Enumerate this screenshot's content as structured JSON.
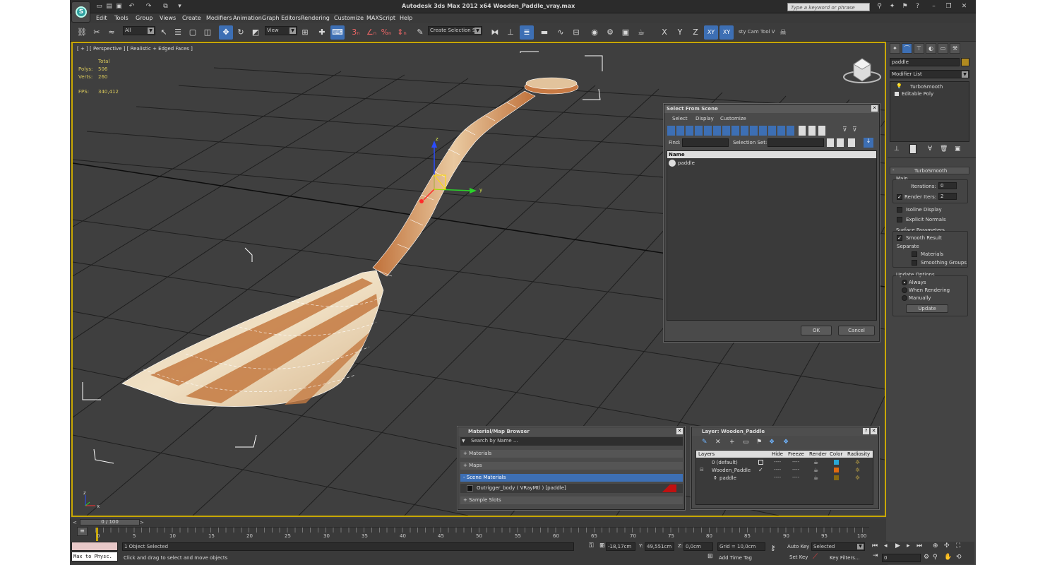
{
  "window": {
    "title": "Autodesk 3ds Max  2012 x64     Wooden_Paddle_vray.max",
    "search_placeholder": "Type a keyword or phrase"
  },
  "menu": [
    "Edit",
    "Tools",
    "Group",
    "Views",
    "Create",
    "Modifiers",
    "Animation",
    "Graph Editors",
    "Rendering",
    "Customize",
    "MAXScript",
    "Help"
  ],
  "toolbar": {
    "filter_value": "All",
    "ref_coord_value": "View",
    "named_selection_placeholder": "Create Selection Se",
    "axis_x": "X",
    "axis_y": "Y",
    "axis_z": "Z",
    "axis_xy": "XY",
    "axis_xy2": "XY",
    "extra_label": "sty Cam Tool V"
  },
  "viewport": {
    "label": "[ + ] [ Perspective ] [ Realistic + Edged Faces ]",
    "stats_header": "Total",
    "polys_label": "Polys:",
    "polys_value": "506",
    "verts_label": "Verts:",
    "verts_value": "260",
    "fps_label": "FPS:",
    "fps_value": "340,412",
    "gizmo_y": "y",
    "gizmo_z": "z",
    "axis_icon_x": "x",
    "axis_icon_z": "z"
  },
  "command_panel": {
    "object_name": "paddle",
    "modifier_list_label": "Modifier List",
    "stack_items": [
      "TurboSmooth",
      "Editable Poly"
    ],
    "rollout_title": "TurboSmooth",
    "main_label": "Main",
    "iterations_label": "Iterations:",
    "iterations_value": "0",
    "render_iters_label": "Render Iters:",
    "render_iters_value": "2",
    "isoline_label": "Isoline Display",
    "explicit_normals_label": "Explicit Normals",
    "surface_params_label": "Surface Parameters",
    "smooth_result_label": "Smooth Result",
    "separate_label": "Separate",
    "materials_label": "Materials",
    "smoothing_groups_label": "Smoothing Groups",
    "update_options_label": "Update Options",
    "always_label": "Always",
    "when_rendering_label": "When Rendering",
    "manually_label": "Manually",
    "update_button": "Update"
  },
  "select_dialog": {
    "title": "Select From Scene",
    "menu": [
      "Select",
      "Display",
      "Customize"
    ],
    "find_label": "Find:",
    "selection_set_label": "Selection Set:",
    "column_name": "Name",
    "items": [
      "paddle"
    ],
    "ok": "OK",
    "cancel": "Cancel"
  },
  "material_browser": {
    "title": "Material/Map Browser",
    "search_placeholder": "Search by Name ...",
    "sections": {
      "materials": "+ Materials",
      "maps": "+ Maps",
      "scene_materials": "- Scene Materials",
      "sample_slots": "+ Sample Slots"
    },
    "scene_material_item": "Outrigger_body  ( VRayMtl ) [paddle]"
  },
  "layer_dialog": {
    "title": "Layer: Wooden_Paddle",
    "columns": [
      "Layers",
      "Hide",
      "Freeze",
      "Render",
      "Color",
      "Radiosity"
    ],
    "rows": [
      {
        "name": "0 (default)",
        "hide": "----",
        "freeze": "----",
        "color": "#2aa7d6"
      },
      {
        "name": "Wooden_Paddle",
        "hide": "----",
        "freeze": "----",
        "color": "#e06a10"
      },
      {
        "name": "paddle",
        "hide": "----",
        "freeze": "----",
        "color": "#8a6a10"
      }
    ]
  },
  "timeline": {
    "frame_range": "0 / 100",
    "ticks": [
      "0",
      "5",
      "10",
      "15",
      "20",
      "25",
      "30",
      "35",
      "40",
      "45",
      "50",
      "55",
      "60",
      "65",
      "70",
      "75",
      "80",
      "85",
      "90",
      "95",
      "100"
    ]
  },
  "status_bar": {
    "maxscript_listener": "Max to Physc.",
    "selection_status": "1 Object Selected",
    "prompt": "Click and drag to select and move objects",
    "x_label": "X:",
    "x_value": "-18,17cm",
    "y_label": "Y:",
    "y_value": "49,551cm",
    "z_label": "Z:",
    "z_value": "0,0cm",
    "grid": "Grid = 10,0cm",
    "add_time_tag": "Add Time Tag",
    "auto_key": "Auto Key",
    "set_key": "Set Key",
    "selected_value": "Selected",
    "key_filters": "Key Filters...",
    "current_frame": "0"
  },
  "colors": {
    "viewport_border": "#c8a700",
    "active_blue": "#3d6fb4",
    "wood_light": "#e8d4b4",
    "wood_dark": "#c0713a"
  }
}
